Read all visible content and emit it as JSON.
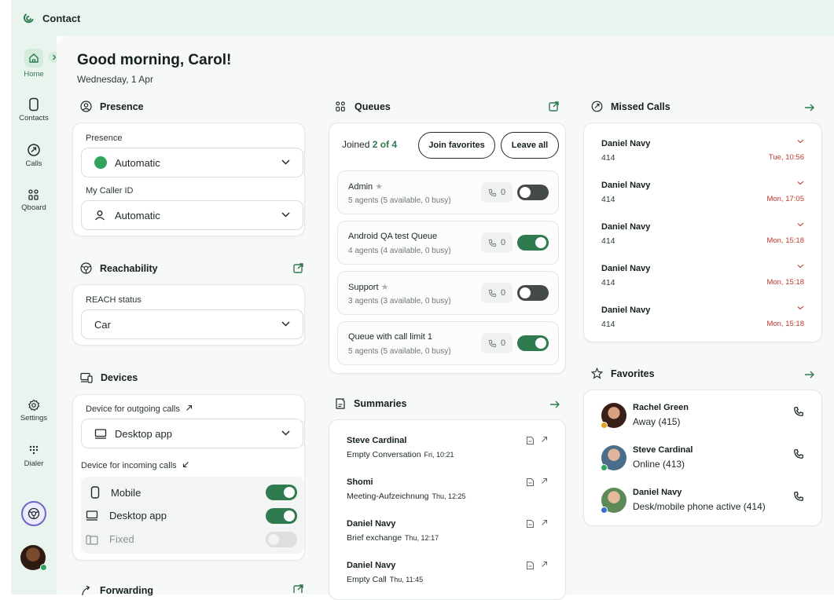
{
  "app": {
    "title": "Contact"
  },
  "nav": {
    "home": "Home",
    "contacts": "Contacts",
    "calls": "Calls",
    "qboard": "Qboard",
    "settings": "Settings",
    "dialer": "Dialer"
  },
  "header": {
    "greeting": "Good morning, Carol!",
    "date": "Wednesday, 1 Apr"
  },
  "presence": {
    "title": "Presence",
    "presence_label": "Presence",
    "presence_value": "Automatic",
    "caller_id_label": "My Caller ID",
    "caller_id_value": "Automatic"
  },
  "reachability": {
    "title": "Reachability",
    "status_label": "REACH status",
    "status_value": "Car"
  },
  "devices": {
    "title": "Devices",
    "outgoing_label": "Device for outgoing calls",
    "outgoing_value": "Desktop app",
    "incoming_label": "Device for incoming calls",
    "incoming": [
      {
        "name": "Mobile",
        "state": "on"
      },
      {
        "name": "Desktop app",
        "state": "on"
      },
      {
        "name": "Fixed",
        "state": "disabled"
      }
    ]
  },
  "forwarding": {
    "title": "Forwarding"
  },
  "queues": {
    "title": "Queues",
    "joined_prefix": "Joined",
    "joined_count": "2 of 4",
    "join_favorites": "Join favorites",
    "leave_all": "Leave all",
    "items": [
      {
        "name": "Admin",
        "favorite": true,
        "agents": "5 agents (5 available, 0 busy)",
        "calls": "0",
        "joined": false
      },
      {
        "name": "Android QA test Queue",
        "favorite": false,
        "agents": "4 agents (4 available, 0 busy)",
        "calls": "0",
        "joined": true
      },
      {
        "name": "Support",
        "favorite": true,
        "agents": "3 agents (3 available, 0 busy)",
        "calls": "0",
        "joined": false
      },
      {
        "name": "Queue with call limit 1",
        "favorite": false,
        "agents": "5 agents (5 available, 0 busy)",
        "calls": "0",
        "joined": true
      }
    ]
  },
  "summaries": {
    "title": "Summaries",
    "items": [
      {
        "name": "Steve Cardinal",
        "desc": "Empty Conversation",
        "time": "Fri, 10:21"
      },
      {
        "name": "Shomi",
        "desc": "Meeting-Aufzeichnung",
        "time": "Thu, 12:25"
      },
      {
        "name": "Daniel Navy",
        "desc": "Brief exchange",
        "time": "Thu, 12:17"
      },
      {
        "name": "Daniel Navy",
        "desc": "Empty Call",
        "time": "Thu, 11:45"
      }
    ]
  },
  "missed_calls": {
    "title": "Missed Calls",
    "items": [
      {
        "name": "Daniel Navy",
        "number": "414",
        "time": "Tue, 10:56"
      },
      {
        "name": "Daniel Navy",
        "number": "414",
        "time": "Mon, 17:05"
      },
      {
        "name": "Daniel Navy",
        "number": "414",
        "time": "Mon, 15:18"
      },
      {
        "name": "Daniel Navy",
        "number": "414",
        "time": "Mon, 15:18"
      },
      {
        "name": "Daniel Navy",
        "number": "414",
        "time": "Mon, 15:18"
      }
    ]
  },
  "favorites": {
    "title": "Favorites",
    "items": [
      {
        "name": "Rachel Green",
        "status": "Away (415)",
        "status_color": "#e0a21b"
      },
      {
        "name": "Steve Cardinal",
        "status": "Online (413)",
        "status_color": "#2fa35a"
      },
      {
        "name": "Daniel Navy",
        "status": "Desk/mobile phone active (414)",
        "status_color": "#3b6fd8"
      }
    ]
  },
  "colors": {
    "accent": "#2f7a4e",
    "missed": "#c0392b",
    "nav_bg": "#e9f4ee",
    "presence_green": "#2fa35a"
  }
}
